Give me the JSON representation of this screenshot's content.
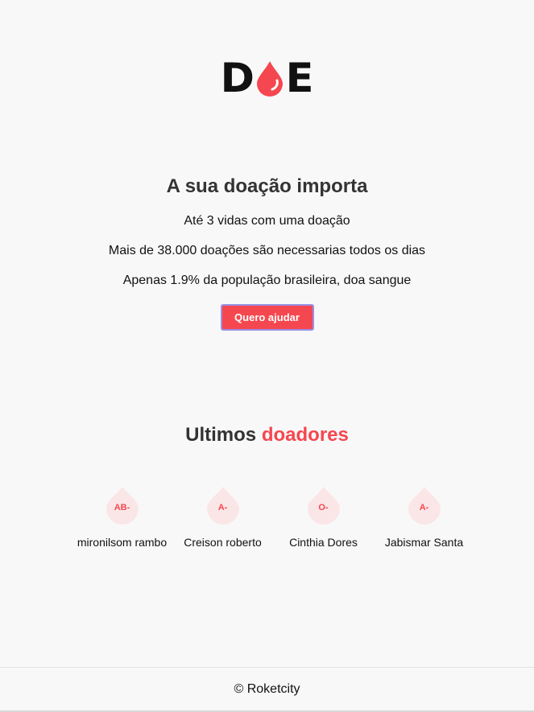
{
  "logo": {
    "letter_left": "D",
    "letter_right": "E",
    "drop_color": "#f5474f"
  },
  "hero": {
    "title": "A sua doação importa",
    "lines": [
      "Até 3 vidas com uma doação",
      "Mais de 38.000 doações são necessarias todos os dias",
      "Apenas 1.9% da população brasileira, doa sangue"
    ],
    "button_label": "Quero ajudar"
  },
  "donors": {
    "title_plain": "Ultimos",
    "title_accent": "doadores",
    "items": [
      {
        "blood_type": "AB-",
        "name": "mironilsom rambo"
      },
      {
        "blood_type": "A-",
        "name": "Creison roberto"
      },
      {
        "blood_type": "O-",
        "name": "Cinthia Dores"
      },
      {
        "blood_type": "A-",
        "name": "Jabismar Santa"
      }
    ]
  },
  "footer": {
    "text": "© Roketcity"
  },
  "colors": {
    "accent": "#f5474f",
    "background": "#f8f8f9",
    "drop_badge_bg": "#fbe6e7"
  }
}
